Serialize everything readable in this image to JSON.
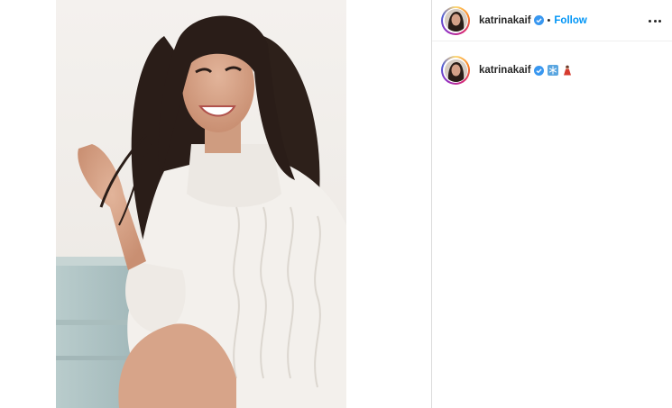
{
  "post": {
    "username": "katrinakaif",
    "follow_label": "Follow",
    "separator": "•",
    "caption_emojis": [
      "snowflake-emoji",
      "woman-in-dress-emoji"
    ]
  },
  "colors": {
    "link_blue": "#0095f6",
    "verified_blue": "#3897f0",
    "divider": "#dbdbdb",
    "text": "#262626"
  }
}
